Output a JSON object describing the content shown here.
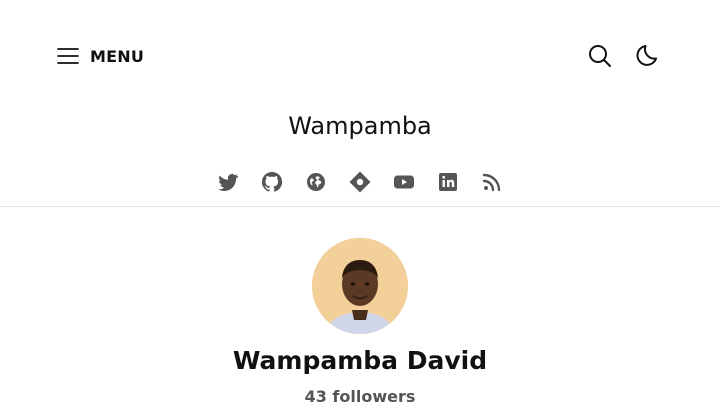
{
  "header": {
    "menu_label": "MENU",
    "menu_icon": "hamburger-icon",
    "search_icon": "search-icon",
    "theme_icon": "moon-icon"
  },
  "blog": {
    "title": "Wampamba"
  },
  "social_links": [
    {
      "icon": "twitter-icon"
    },
    {
      "icon": "github-icon"
    },
    {
      "icon": "globe-icon"
    },
    {
      "icon": "map-pin-icon"
    },
    {
      "icon": "youtube-icon"
    },
    {
      "icon": "linkedin-icon"
    },
    {
      "icon": "rss-icon"
    }
  ],
  "profile": {
    "name": "Wampamba David",
    "followers": "43 followers"
  },
  "colors": {
    "text": "#111111",
    "icon": "#555555",
    "muted": "#555555",
    "divider": "#e5e5e5",
    "avatar_bg": "#f3cf99"
  }
}
